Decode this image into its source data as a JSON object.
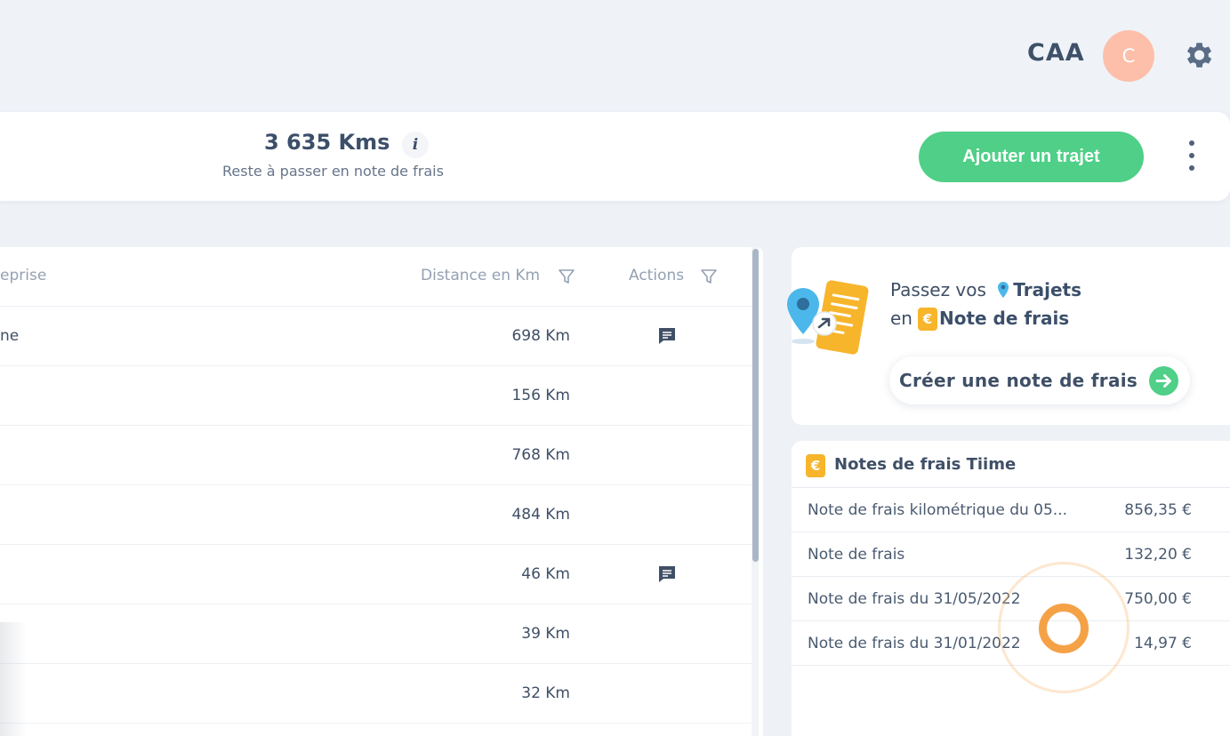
{
  "header": {
    "company": "CAA",
    "avatar_initial": "C",
    "settings_icon": "gear-icon"
  },
  "summary": {
    "kms_value": "3 635 Kms",
    "info_label": "i",
    "subtitle": "Reste à passer en note de frais",
    "add_button": "Ajouter un trajet",
    "more_icon": "kebab-menu-icon"
  },
  "table": {
    "columns": {
      "company": "eprise",
      "distance": "Distance en Km",
      "actions": "Actions"
    },
    "rows": [
      {
        "name": "ne",
        "distance": "698 Km",
        "comment": true
      },
      {
        "name": "",
        "distance": "156 Km",
        "comment": false
      },
      {
        "name": "",
        "distance": "768 Km",
        "comment": false
      },
      {
        "name": "",
        "distance": "484 Km",
        "comment": false
      },
      {
        "name": "",
        "distance": "46 Km",
        "comment": true
      },
      {
        "name": "",
        "distance": "39 Km",
        "comment": false
      },
      {
        "name": "",
        "distance": "32 Km",
        "comment": false
      }
    ]
  },
  "promo": {
    "line1_prefix": "Passez vos",
    "line1_strong": "Trajets",
    "line2_prefix": "en",
    "euro_symbol": "€",
    "line2_strong": "Note de frais",
    "create_button": "Créer une note de frais"
  },
  "notes": {
    "euro_symbol": "€",
    "title": "Notes de frais Tiime",
    "items": [
      {
        "label": "Note de frais kilométrique du 05...",
        "amount": "856,35 €"
      },
      {
        "label": "Note de frais",
        "amount": "132,20 €"
      },
      {
        "label": "Note de frais du 31/05/2022",
        "amount": "750,00 €"
      },
      {
        "label": "Note de frais du 31/01/2022",
        "amount": "14,97 €"
      }
    ]
  },
  "colors": {
    "accent_green": "#4fcf87",
    "accent_orange": "#f7b52c",
    "avatar_bg": "#fdbfa9",
    "pin_blue": "#4bb7ea"
  }
}
